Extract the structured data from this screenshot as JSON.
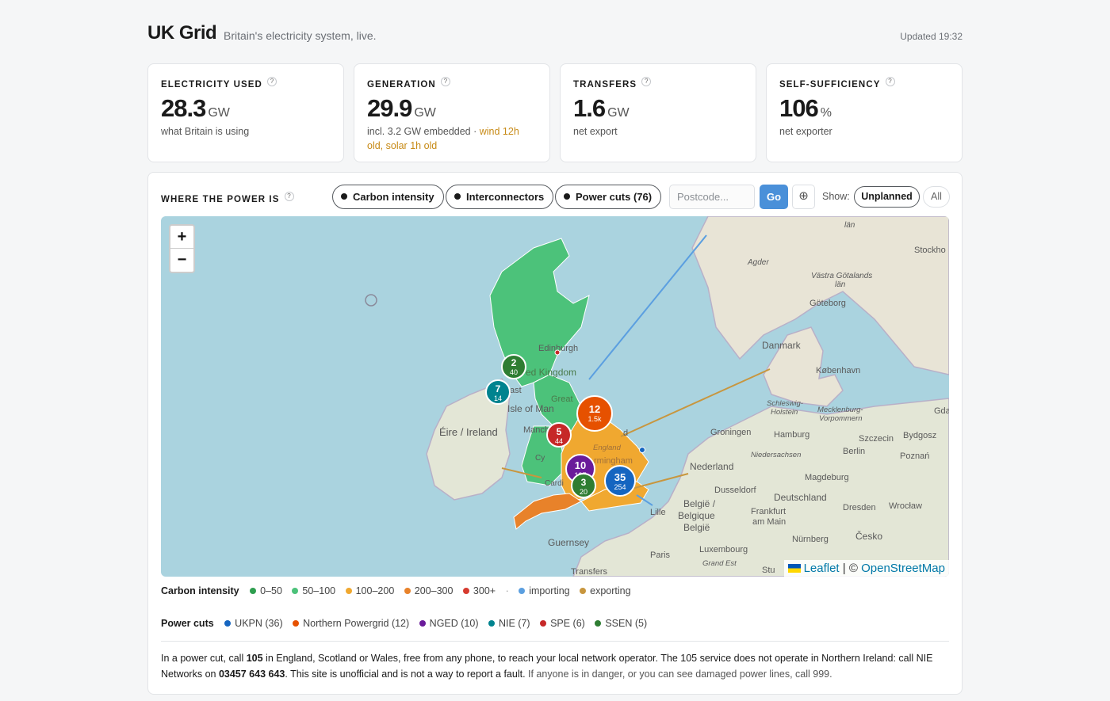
{
  "header": {
    "title": "UK Grid",
    "subtitle": "Britain's electricity system, live.",
    "updated": "Updated 19:32"
  },
  "cards": [
    {
      "label": "ELECTRICITY USED",
      "help": "?",
      "value": "28.3",
      "unit": "GW",
      "note": "what Britain is using"
    },
    {
      "label": "GENERATION",
      "help": "?",
      "value": "29.9",
      "unit": "GW",
      "note": "incl. 3.2 GW embedded",
      "note_sep": " · ",
      "note_warn": "wind 12h old, solar 1h old"
    },
    {
      "label": "TRANSFERS",
      "help": "?",
      "value": "1.6",
      "unit": "GW",
      "note": "net export"
    },
    {
      "label": "SELF-SUFFICIENCY",
      "help": "?",
      "value": "106",
      "unit": "%",
      "note": "net exporter"
    }
  ],
  "panel": {
    "label": "WHERE THE POWER IS",
    "help": "?",
    "toggles": {
      "carbon": "Carbon intensity",
      "interconnectors": "Interconnectors",
      "powercuts": "Power cuts (76)"
    },
    "postcode_placeholder": "Postcode...",
    "go": "Go",
    "locate_icon": "⊕",
    "show_label": "Show:",
    "filter_on": "Unplanned",
    "filter_off": "All"
  },
  "map": {
    "zoom_in": "+",
    "zoom_out": "−",
    "attribution": {
      "leaflet": "Leaflet",
      "sep": "|",
      "copy": "©",
      "osm": "OpenStreetMap"
    },
    "place_labels": {
      "stockholm": "Stockho",
      "agder": "Agder",
      "goteborg": "Göteborg",
      "vastra": "Västra Götalands",
      "lan": "län",
      "lan_top": "län",
      "danmark": "Danmark",
      "kobenhavn": "København",
      "schleswig": "Schleswig-",
      "holstein": "Holstein",
      "mecklenburg": "Mecklenburg-",
      "vorpommern": "Vorpommern",
      "gda": "Gda",
      "groningen": "Groningen",
      "hamburg": "Hamburg",
      "szczecin": "Szczecin",
      "bydgosz": "Bydgosz",
      "niedersachsen": "Niedersachsen",
      "berlin": "Berlin",
      "poznan": "Poznań",
      "nederland": "Nederland",
      "magdeburg": "Magdeburg",
      "dusseldorf": "Dusseldorf",
      "deutschland": "Deutschland",
      "dresden": "Dresden",
      "wroclaw": "Wrocław",
      "belgie": "België /",
      "belgique": "Belgique",
      "belgien": "België",
      "lille": "Lille",
      "frankfurt": "Frankfurt",
      "ammain": "am Main",
      "nurnberg": "Nürnberg",
      "cesko": "Česko",
      "luxembourg": "Luxembourg",
      "paris": "Paris",
      "grandest": "Grand Est",
      "stu": "Stu",
      "guernsey": "Guernsey",
      "transfers": "Transfers",
      "eire": "Éire / Ireland",
      "isleofman": "Isle of Man",
      "edinburgh": "Edinburgh",
      "kingdom": "ed Kingdom",
      "manch": "Manch",
      "ast": "ast",
      "great": "Great",
      "england": "England",
      "birmingham": "rmingham",
      "cardi": "Cardi",
      "cy": "Cy",
      "hd": "d",
      "lva": "lba"
    },
    "clusters": [
      {
        "count": "2",
        "sub": "40",
        "color": "#2e7d32"
      },
      {
        "count": "7",
        "sub": "14",
        "color": "#00838f"
      },
      {
        "count": "12",
        "sub": "1.5k",
        "color": "#e65100"
      },
      {
        "count": "5",
        "sub": "44",
        "color": "#c62828"
      },
      {
        "count": "10",
        "sub": "127",
        "color": "#6a1b9a"
      },
      {
        "count": "3",
        "sub": "20",
        "color": "#2e7d32"
      },
      {
        "count": "35",
        "sub": "254",
        "color": "#1565c0"
      }
    ]
  },
  "legend": {
    "carbon": {
      "label": "Carbon intensity",
      "items": [
        {
          "text": "0–50",
          "color": "#2e9e4f"
        },
        {
          "text": "50–100",
          "color": "#4cc27a"
        },
        {
          "text": "100–200",
          "color": "#f0a830"
        },
        {
          "text": "200–300",
          "color": "#e8822a"
        },
        {
          "text": "300+",
          "color": "#d63b2f"
        }
      ],
      "sep": "·",
      "flows": [
        {
          "text": "importing",
          "color": "#5b9fe0"
        },
        {
          "text": "exporting",
          "color": "#c8963e"
        }
      ]
    },
    "cuts": {
      "label": "Power cuts",
      "items": [
        {
          "text": "UKPN (36)",
          "color": "#1565c0"
        },
        {
          "text": "Northern Powergrid (12)",
          "color": "#e65100"
        },
        {
          "text": "NGED (10)",
          "color": "#6a1b9a"
        },
        {
          "text": "NIE (7)",
          "color": "#00838f"
        },
        {
          "text": "SPE (6)",
          "color": "#c62828"
        },
        {
          "text": "SSEN (5)",
          "color": "#2e7d32"
        }
      ]
    }
  },
  "notice": {
    "t1": "In a power cut, call ",
    "n1": "105",
    "t2": " in England, Scotland or Wales, free from any phone, to reach your local network operator. The 105 service does not operate in Northern Ireland: call NIE Networks on ",
    "n2": "03457 643 643",
    "t3": ". This site is unofficial and is not a way to report a fault. ",
    "muted": "If anyone is in danger, or you can see damaged power lines, call 999."
  }
}
